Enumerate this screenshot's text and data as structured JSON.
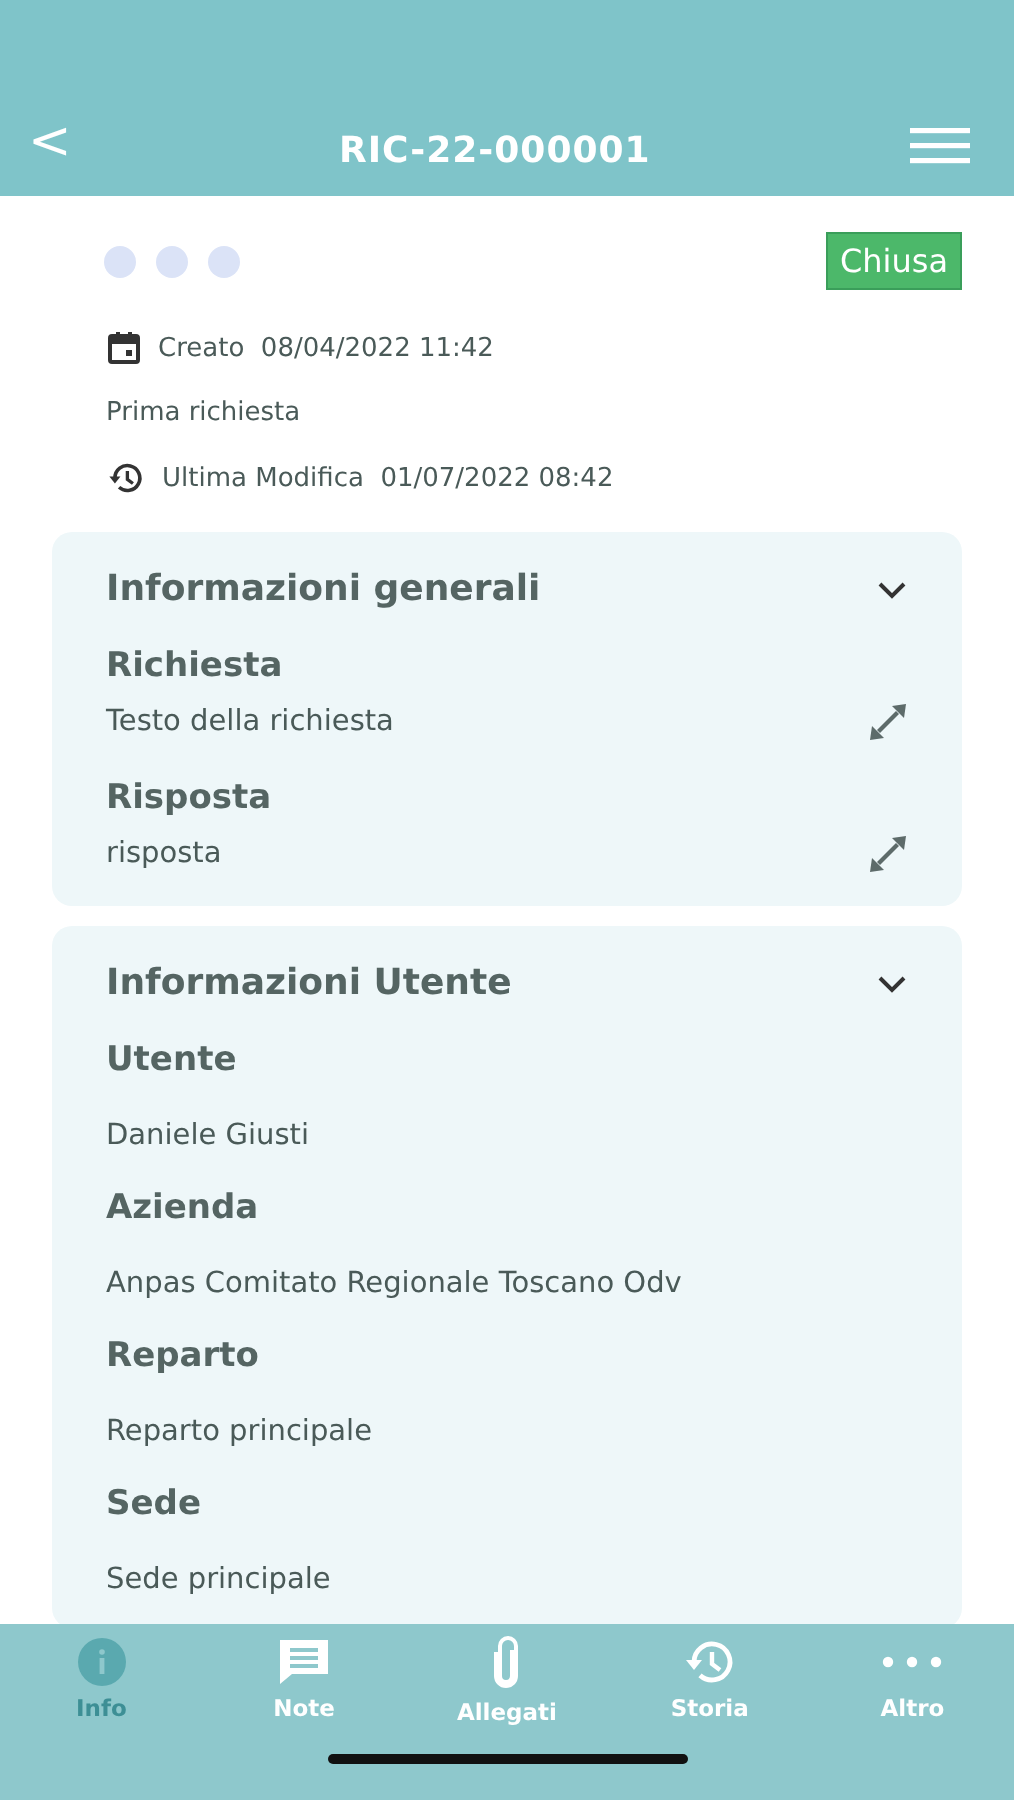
{
  "header": {
    "back": "<",
    "title": "RIC-22-000001"
  },
  "status": {
    "label": "Chiusa",
    "color": "#4cb86a"
  },
  "meta": {
    "created_label": "Creato",
    "created": "08/04/2022 11:42",
    "subtitle": "Prima richiesta",
    "modified_label": "Ultima Modifica",
    "modified": "01/07/2022 08:42"
  },
  "sections": [
    {
      "title": "Informazioni generali",
      "expanded": true,
      "fields": [
        {
          "label": "Richiesta",
          "value": "Testo della richiesta",
          "expandable": true
        },
        {
          "label": "Risposta",
          "value": "risposta",
          "expandable": true
        }
      ]
    },
    {
      "title": "Informazioni Utente",
      "expanded": true,
      "fields": [
        {
          "label": "Utente",
          "value": "Daniele Giusti",
          "expandable": false
        },
        {
          "label": "Azienda",
          "value": "Anpas Comitato Regionale Toscano Odv",
          "expandable": false
        },
        {
          "label": "Reparto",
          "value": "Reparto principale",
          "expandable": false
        },
        {
          "label": "Sede",
          "value": "Sede principale",
          "expandable": false
        }
      ]
    }
  ],
  "tabs": [
    {
      "kind": "info",
      "label": "Info",
      "selected": true
    },
    {
      "kind": "note",
      "label": "Note",
      "selected": false
    },
    {
      "kind": "attach",
      "label": "Allegati",
      "selected": false
    },
    {
      "kind": "history",
      "label": "Storia",
      "selected": false
    },
    {
      "kind": "more",
      "label": "Altro",
      "selected": false
    }
  ]
}
